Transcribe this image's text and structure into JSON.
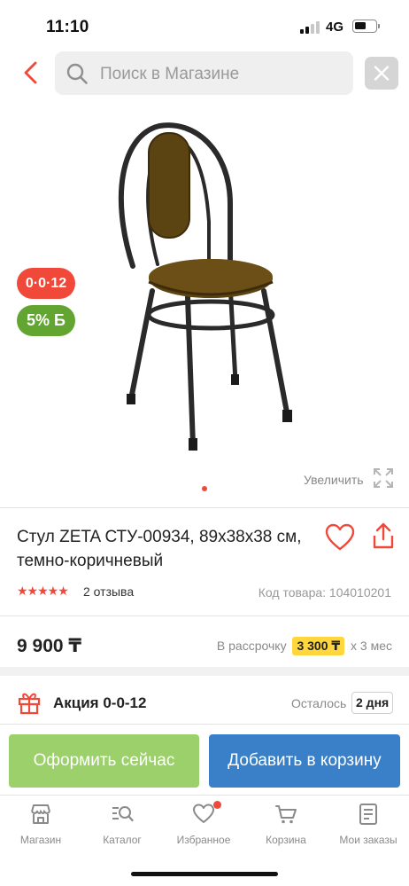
{
  "status_bar": {
    "time": "11:10",
    "network": "4G"
  },
  "search": {
    "placeholder": "Поиск в Магазине"
  },
  "gallery": {
    "badges": {
      "installment": "0·0·12",
      "bonus": "5% Б"
    },
    "zoom_label": "Увеличить",
    "current_image": 1
  },
  "product": {
    "title": "Стул ZETA СТУ-00934, 89х38х38 см, темно-коричневый",
    "rating": {
      "stars": 5,
      "reviews": "2 отзыва"
    },
    "sku": "Код товара: 104010201",
    "price": "9 900 ₸",
    "installment": {
      "prefix": "В рассрочку",
      "amount": "3 300 ₸",
      "suffix": "х 3 мес"
    }
  },
  "promo": {
    "label": "Акция 0-0-12",
    "remaining_label": "Осталось",
    "remaining_value": "2 дня"
  },
  "actions": {
    "buy_now": "Оформить сейчас",
    "add_to_cart": "Добавить в корзину"
  },
  "tabbar": {
    "items": [
      {
        "label": "Магазин",
        "icon": "shop-icon"
      },
      {
        "label": "Каталог",
        "icon": "catalog-search-icon"
      },
      {
        "label": "Избранное",
        "icon": "heart-icon",
        "notification": true
      },
      {
        "label": "Корзина",
        "icon": "cart-icon"
      },
      {
        "label": "Мои заказы",
        "icon": "orders-icon"
      }
    ]
  },
  "colors": {
    "accent": "#f0493a",
    "buy_now": "#9bd06a",
    "add_to_cart": "#3a80c8",
    "bonus": "#62a531",
    "installment_highlight": "#ffd63c"
  }
}
